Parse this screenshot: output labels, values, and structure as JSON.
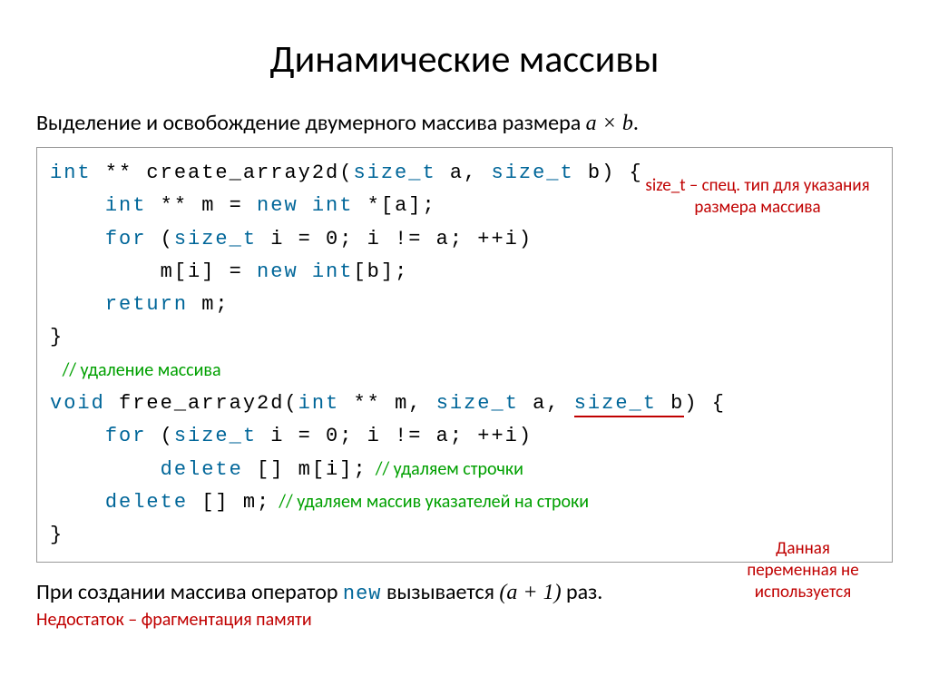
{
  "title": "Динамические массивы",
  "subtitle_pre": "Выделение и освобождение двумерного массива размера ",
  "subtitle_math": "a × b",
  "subtitle_post": ".",
  "code": {
    "l1_kw1": "int",
    "l1_txt": " ** create_array2d(",
    "l1_kw2": "size_t",
    "l1_txt2": " a, ",
    "l1_kw3": "size_t",
    "l1_txt3": " b) {",
    "l2_ind": "    ",
    "l2_kw1": "int",
    "l2_txt": " ** m = ",
    "l2_kw2": "new",
    "l2_txt2": " ",
    "l2_kw3": "int",
    "l2_txt3": " *[a];",
    "l3_ind": "    ",
    "l3_kw1": "for",
    "l3_txt": " (",
    "l3_kw2": "size_t",
    "l3_txt2": " i = 0; i != a; ++i)",
    "l4_ind": "        ",
    "l4_txt": "m[i] = ",
    "l4_kw1": "new",
    "l4_txt2": " ",
    "l4_kw2": "int",
    "l4_txt3": "[b];",
    "l5_ind": "    ",
    "l5_kw1": "return",
    "l5_txt": " m;",
    "l6_txt": "}",
    "l7_green": "   // удаление массива",
    "l8_kw1": "void",
    "l8_txt": " free_array2d(",
    "l8_kw2": "int",
    "l8_txt2": " ** m, ",
    "l8_kw3": "size_t",
    "l8_txt3": " a, ",
    "l8_kw4": "size_t",
    "l8_txt4": " b",
    "l8_txt5": ") {",
    "l9_ind": "    ",
    "l9_kw1": "for",
    "l9_txt": " (",
    "l9_kw2": "size_t",
    "l9_txt2": " i = 0; i != a; ++i)",
    "l10_ind": "        ",
    "l10_kw1": "delete",
    "l10_txt": " [] m[i];",
    "l10_green": "  // удаляем строчки",
    "l11_ind": "    ",
    "l11_kw1": "delete",
    "l11_txt": " [] m;",
    "l11_green": "  // удаляем массив указателей на строки",
    "l12_txt": "}"
  },
  "callouts": {
    "top": "size_t – спец. тип для указания размера массива",
    "right_l1": "Данная",
    "right_l2": "переменная не",
    "right_l3": "используется"
  },
  "footer_pre": "При создании массива оператор ",
  "footer_new": "new",
  "footer_mid": " вызывается ",
  "footer_math": "(a + 1)",
  "footer_post": " раз.",
  "footer_red": "Недостаток – фрагментация памяти"
}
